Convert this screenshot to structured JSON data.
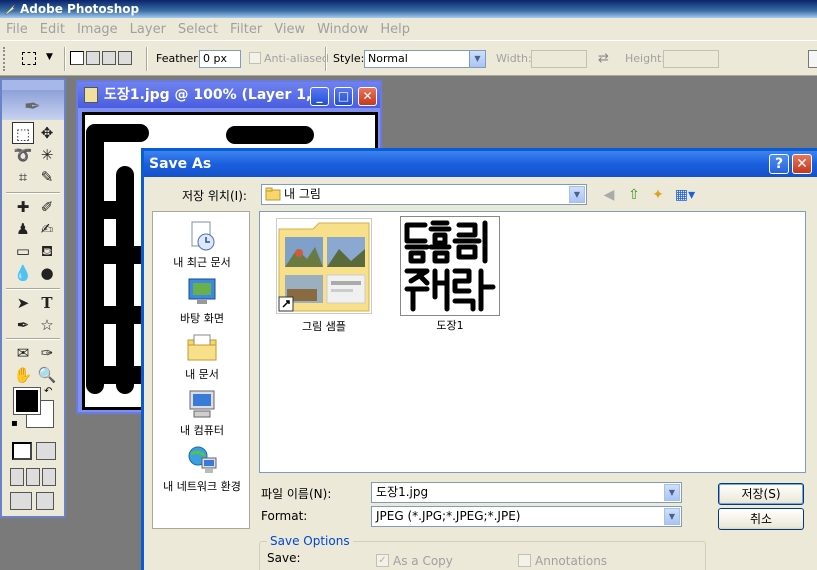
{
  "app": {
    "title": "Adobe Photoshop",
    "icon": "photoshop-feather-icon"
  },
  "menu": [
    "File",
    "Edit",
    "Image",
    "Layer",
    "Select",
    "Filter",
    "View",
    "Window",
    "Help"
  ],
  "options": {
    "feather_label": "Feather:",
    "feather_value": "0 px",
    "antialiased_label": "Anti-aliased",
    "style_label": "Style:",
    "style_value": "Normal",
    "width_label": "Width:",
    "height_label": "Height:"
  },
  "image_window": {
    "title": "도장1.jpg @ 100% (Layer 1,...",
    "btn_min": "_",
    "btn_max": "□",
    "btn_close": "✕"
  },
  "dialog": {
    "title": "Save As",
    "help": "?",
    "close": "✕",
    "save_in_label": "저장 위치(I):",
    "save_in_value": "내 그림",
    "places": [
      {
        "label": "내 최근 문서",
        "icon": "recent-documents-icon"
      },
      {
        "label": "바탕 화면",
        "icon": "desktop-icon"
      },
      {
        "label": "내 문서",
        "icon": "my-documents-icon"
      },
      {
        "label": "내 컴퓨터",
        "icon": "my-computer-icon"
      },
      {
        "label": "내 네트워크 환경",
        "icon": "network-places-icon"
      }
    ],
    "files": [
      {
        "name": "그림 샘플",
        "type": "folder-shortcut"
      },
      {
        "name": "도장1",
        "type": "image"
      }
    ],
    "filename_label": "파일 이름(N):",
    "filename_value": "도장1.jpg",
    "format_label": "Format:",
    "format_value": "JPEG (*.JPG;*.JPEG;*.JPE)",
    "save_button": "저장(S)",
    "cancel_button": "취소",
    "save_options_legend": "Save Options",
    "save_label": "Save:",
    "as_copy_label": "As a Copy",
    "annotations_label": "Annotations"
  },
  "colors": {
    "xp_blue": "#1b5fde",
    "dialog_bg": "#ece9d8",
    "workspace": "#7a7a7a"
  }
}
